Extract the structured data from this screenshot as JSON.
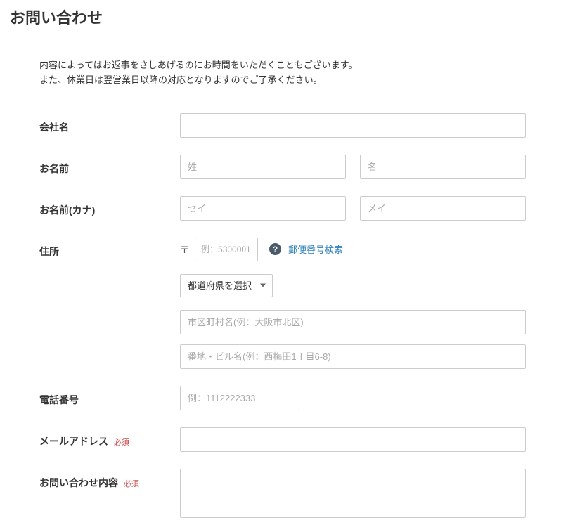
{
  "page_title": "お問い合わせ",
  "intro_line1": "内容によってはお返事をさしあげるのにお時間をいただくこともございます。",
  "intro_line2": "また、休業日は翌営業日以降の対応となりますのでご了承ください。",
  "labels": {
    "company": "会社名",
    "name": "お名前",
    "name_kana": "お名前(カナ)",
    "address": "住所",
    "phone": "電話番号",
    "email": "メールアドレス",
    "content": "お問い合わせ内容"
  },
  "required_text": "必須",
  "placeholders": {
    "sei": "姓",
    "mei": "名",
    "sei_kana": "セイ",
    "mei_kana": "メイ",
    "postal": "例：5300001",
    "city": "市区町村名(例：大阪市北区)",
    "street": "番地・ビル名(例：西梅田1丁目6-8)",
    "phone": "例：1112222333"
  },
  "postal_mark": "〒",
  "postal_search_text": "郵便番号検索",
  "prefecture_placeholder": "都道府県を選択"
}
